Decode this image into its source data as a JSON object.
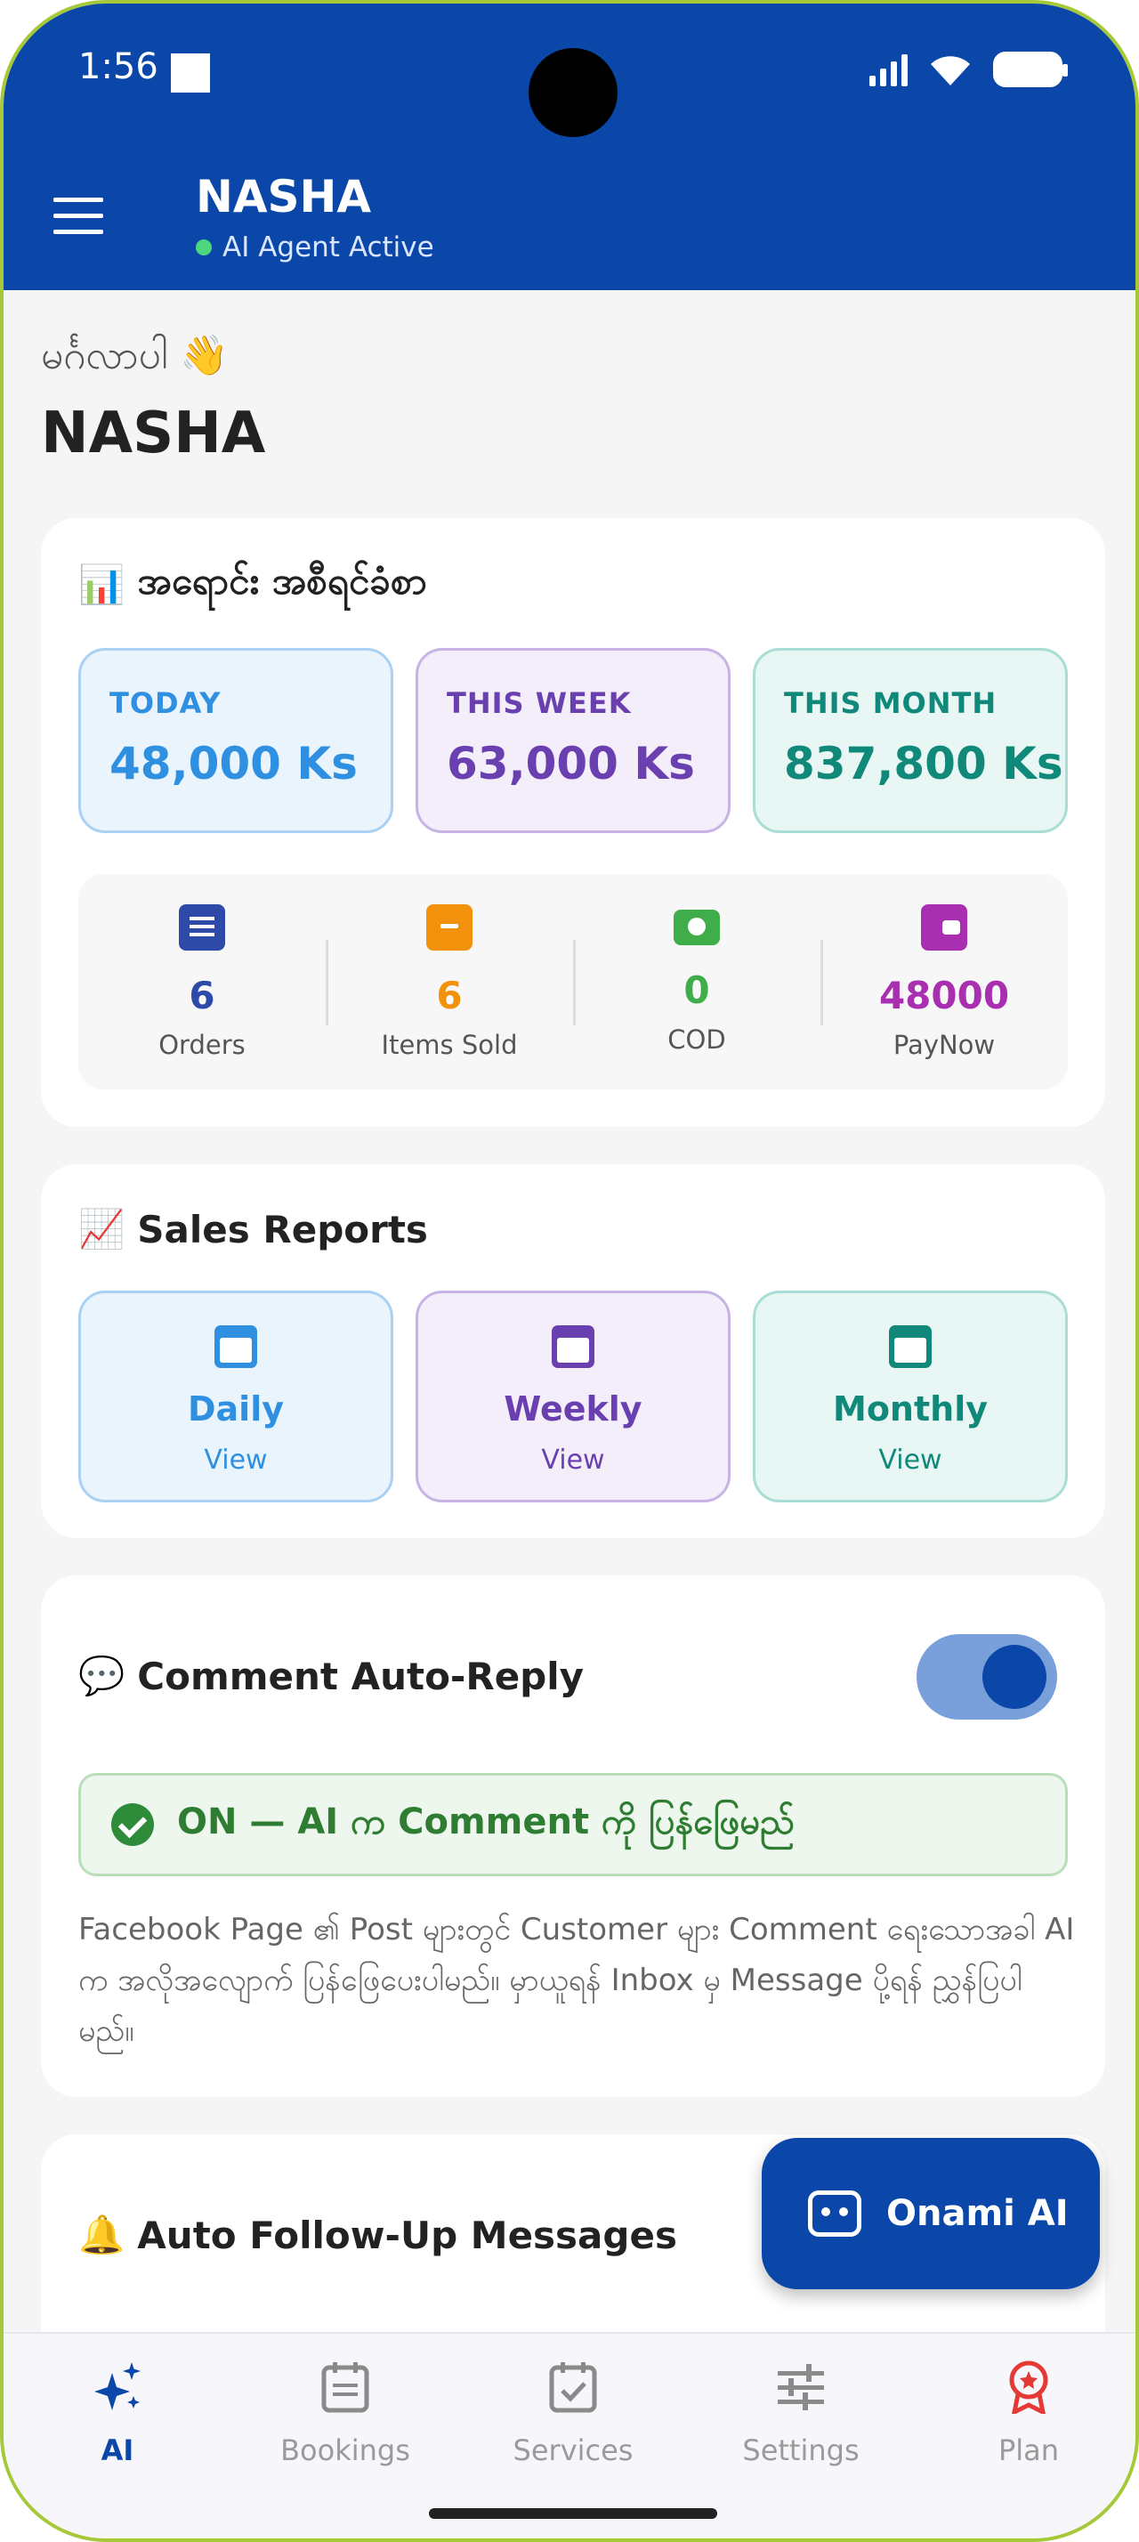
{
  "status_bar": {
    "time": "1:56"
  },
  "app_bar": {
    "title": "NASHA",
    "agent_status": "AI Agent Active"
  },
  "greeting": {
    "hello": "မင်္ဂလာပါ 👋",
    "name": "NASHA"
  },
  "sales_summary": {
    "title": "အရောင်း အစီရင်ခံစာ",
    "emoji": "📊",
    "periods": [
      {
        "label": "TODAY",
        "value": "48,000 Ks",
        "color": "#2f8fe0"
      },
      {
        "label": "THIS WEEK",
        "value": "63,000 Ks",
        "color": "#6a3fb0"
      },
      {
        "label": "THIS MONTH",
        "value": "837,800 Ks",
        "color": "#11897a"
      }
    ],
    "metrics": [
      {
        "value": "6",
        "label": "Orders",
        "icon": "receipt-icon",
        "color": "#2e4aa8"
      },
      {
        "value": "6",
        "label": "Items Sold",
        "icon": "archive-box-icon",
        "color": "#f2920c"
      },
      {
        "value": "0",
        "label": "COD",
        "icon": "cash-icon",
        "color": "#3fae4a"
      },
      {
        "value": "48000",
        "label": "PayNow",
        "icon": "wallet-icon",
        "color": "#a72fb0"
      }
    ]
  },
  "sales_reports": {
    "title": "Sales Reports",
    "emoji": "📈",
    "items": [
      {
        "title": "Daily",
        "sub": "View",
        "color": "#2f8fe0"
      },
      {
        "title": "Weekly",
        "sub": "View",
        "color": "#6a3fb0"
      },
      {
        "title": "Monthly",
        "sub": "View",
        "color": "#11897a"
      }
    ]
  },
  "comment_auto_reply": {
    "emoji": "💬",
    "title": "Comment Auto-Reply",
    "enabled": true,
    "status_text": "ON — AI က Comment ကို ပြန်ဖြေမည်",
    "description": "Facebook Page ၏ Post များတွင် Customer များ Comment ရေးသောအခါ AI က အလိုအလျောက် ပြန်ဖြေပေးပါမည်။ မှာယူရန် Inbox မှ Message ပို့ရန် ညွှန်ပြပါမည်။"
  },
  "auto_follow_up": {
    "emoji": "🔔",
    "title": "Auto Follow-Up Messages"
  },
  "fab": {
    "label": "Onami AI",
    "icon": "robot-icon"
  },
  "bottom_nav": [
    {
      "label": "AI",
      "icon": "sparkles-icon",
      "active": true
    },
    {
      "label": "Bookings",
      "icon": "calendar-icon",
      "active": false
    },
    {
      "label": "Services",
      "icon": "calendar-check-icon",
      "active": false
    },
    {
      "label": "Settings",
      "icon": "sliders-icon",
      "active": false
    },
    {
      "label": "Plan",
      "icon": "award-icon",
      "active": false
    }
  ],
  "colors": {
    "primary": "#0a47a8",
    "success": "#2e7d32"
  }
}
